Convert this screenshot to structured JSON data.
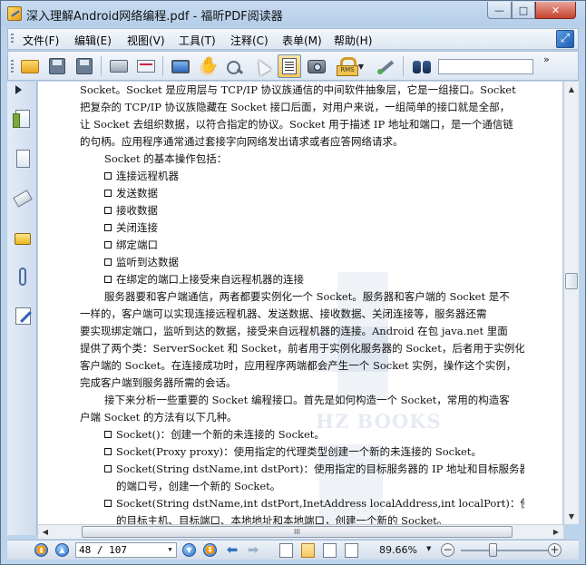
{
  "window": {
    "title": "深入理解Android网络编程.pdf - 福昕PDF阅读器",
    "minimize": "—",
    "maximize": "□",
    "close": "✕"
  },
  "menu": {
    "items": [
      "文件(F)",
      "编辑(E)",
      "视图(V)",
      "工具(T)",
      "注释(C)",
      "表单(M)",
      "帮助(H)"
    ]
  },
  "toolbar": {
    "icons": [
      "open-folder-icon",
      "save-icon",
      "save-as-icon",
      "print-icon",
      "scan-icon",
      "fullscreen-icon",
      "hand-tool-icon",
      "zoom-select-icon",
      "select-cursor-icon",
      "text-select-icon",
      "snapshot-icon",
      "rms-icon",
      "sign-icon",
      "find-icon"
    ],
    "search_value": "",
    "more": "»"
  },
  "document": {
    "lines": [
      {
        "kind": "para",
        "text": "Socket。Socket 是应用层与 TCP/IP 协议族通信的中间软件抽象层，它是一组接口。Socket"
      },
      {
        "kind": "para",
        "text": "把复杂的 TCP/IP 协议族隐藏在 Socket 接口后面，对用户来说，一组简单的接口就是全部，"
      },
      {
        "kind": "para",
        "text": "让 Socket 去组织数据，以符合指定的协议。Socket 用于描述 IP 地址和端口，是一个通信链"
      },
      {
        "kind": "para",
        "text": "的句柄。应用程序通常通过套接字向网络发出请求或者应答网络请求。"
      },
      {
        "kind": "indent",
        "text": "Socket 的基本操作包括："
      },
      {
        "kind": "bullet",
        "text": "连接远程机器"
      },
      {
        "kind": "bullet",
        "text": "发送数据"
      },
      {
        "kind": "bullet",
        "text": "接收数据"
      },
      {
        "kind": "bullet",
        "text": "关闭连接"
      },
      {
        "kind": "bullet",
        "text": "绑定端口"
      },
      {
        "kind": "bullet",
        "text": "监听到达数据"
      },
      {
        "kind": "bullet",
        "text": "在绑定的端口上接受来自远程机器的连接"
      },
      {
        "kind": "indent",
        "text": "服务器要和客户端通信，两者都要实例化一个 Socket。服务器和客户端的 Socket 是不"
      },
      {
        "kind": "para",
        "text": "一样的，客户端可以实现连接远程机器、发送数据、接收数据、关闭连接等，服务器还需"
      },
      {
        "kind": "para",
        "text": "要实现绑定端口，监听到达的数据，接受来自远程机器的连接。Android 在包 java.net 里面"
      },
      {
        "kind": "para",
        "text": "提供了两个类：ServerSocket 和 Socket，前者用于实例化服务器的 Socket，后者用于实例化"
      },
      {
        "kind": "para",
        "text": "客户端的 Socket。在连接成功时，应用程序两端都会产生一个 Socket 实例，操作这个实例，"
      },
      {
        "kind": "para",
        "text": "完成客户端到服务器所需的会话。"
      },
      {
        "kind": "indent",
        "text": "接下来分析一些重要的 Socket 编程接口。首先是如何构造一个 Socket，常用的构造客"
      },
      {
        "kind": "para",
        "text": "户端 Socket 的方法有以下几种。"
      },
      {
        "kind": "bullet",
        "text": "Socket()：创建一个新的未连接的 Socket。"
      },
      {
        "kind": "bullet",
        "text": "Socket(Proxy proxy)：使用指定的代理类型创建一个新的未连接的 Socket。"
      },
      {
        "kind": "bullet",
        "text": "Socket(String dstName,int dstPort)：使用指定的目标服务器的 IP 地址和目标服务器"
      },
      {
        "kind": "cont",
        "text": "的端口号，创建一个新的 Socket。"
      },
      {
        "kind": "bullet",
        "text": "Socket(String dstName,int dstPort,InetAddress localAddress,int localPort)：使用指定"
      },
      {
        "kind": "cont",
        "text": "的目标主机、目标端口、本地地址和本地端口，创建一个新的 Socket。"
      }
    ],
    "watermark": "HZ BOOKS"
  },
  "scrollbars": {
    "h_thumb_grip": "III"
  },
  "nav": {
    "page_value": "48 / 107",
    "zoom_value": "89.66%",
    "zoom_out": "−",
    "zoom_in": "+"
  },
  "colors": {
    "window_frame": "#bcd3ec",
    "close_button": "#c7402e",
    "accent_blue": "#2a6fc4"
  }
}
